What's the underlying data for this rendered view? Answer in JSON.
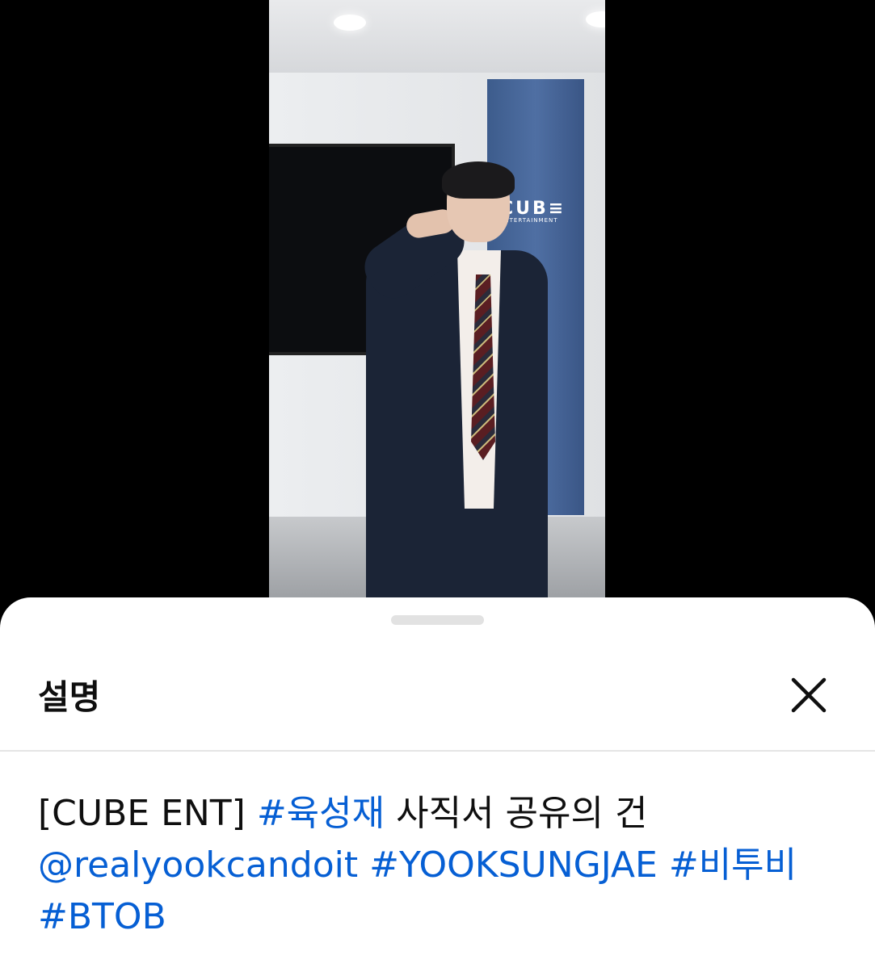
{
  "video": {
    "logo_main": "CUB≡",
    "logo_sub": "ENTERTAINMENT"
  },
  "sheet": {
    "title": "설명",
    "close_icon": "close-icon",
    "description": {
      "prefix": "[CUBE ENT] ",
      "hashtag_name": "#육성재",
      "title_rest": " 사직서 공유의 건",
      "mention": "@realyookcandoit",
      "tag1": "#YOOKSUNGJAE",
      "tag2": "#비투비",
      "tag3": "#BTOB"
    }
  },
  "colors": {
    "link": "#065fd4",
    "text": "#0f0f0f"
  }
}
